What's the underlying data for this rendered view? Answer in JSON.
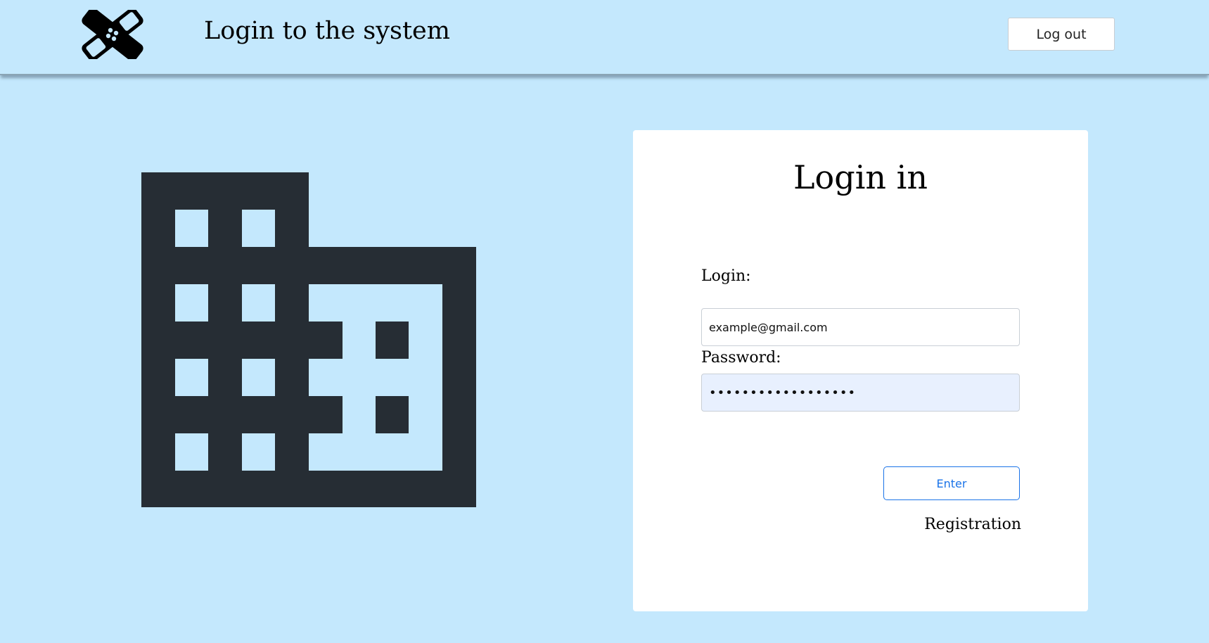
{
  "header": {
    "title": "Login to the system",
    "logout_label": "Log out",
    "logo_icon": "bandage-icon"
  },
  "illustration": {
    "icon": "building-icon",
    "color": "#262d34"
  },
  "login_card": {
    "title": "Login in",
    "login_label": "Login:",
    "login_value": "example@gmail.com",
    "password_label": "Password:",
    "password_value": "••••••••••••••••••",
    "enter_label": "Enter",
    "registration_label": "Registration"
  },
  "colors": {
    "background": "#c4e8fd",
    "accent": "#1a73e8",
    "card": "#ffffff"
  }
}
